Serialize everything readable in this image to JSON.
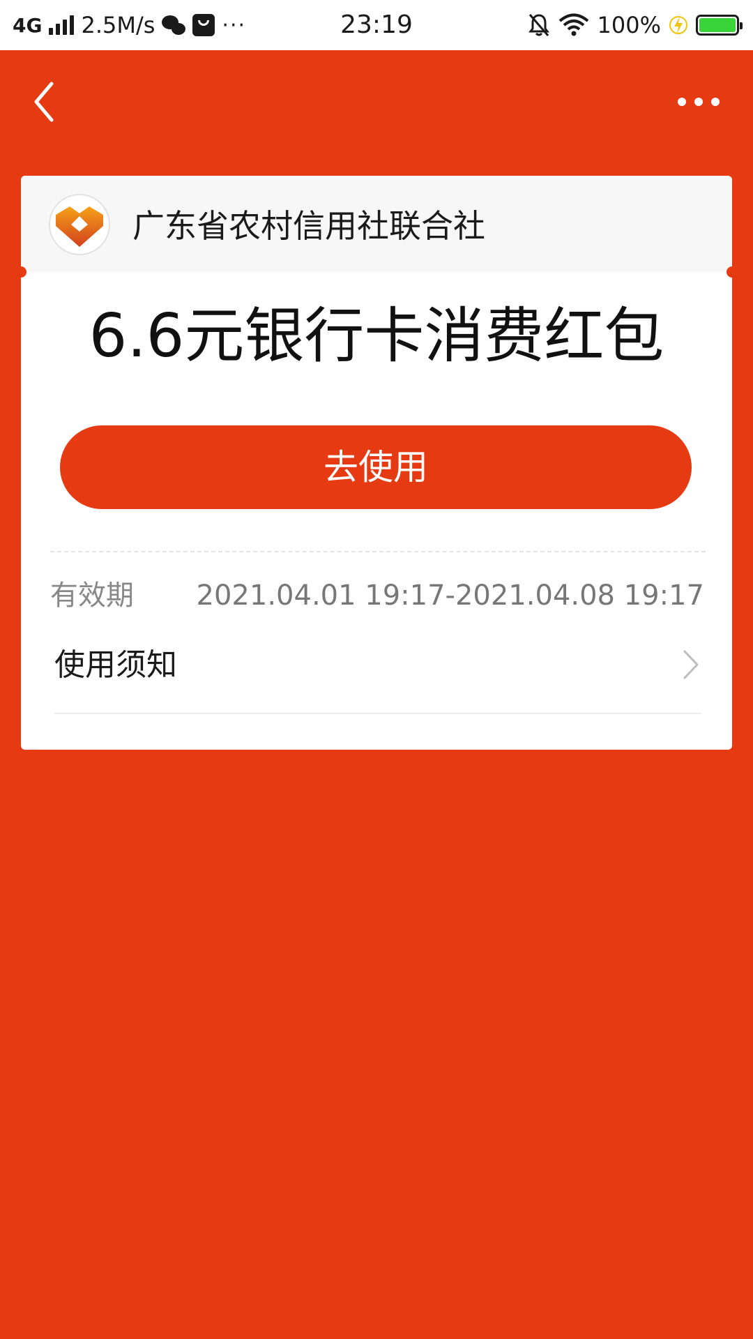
{
  "status_bar": {
    "network": "4G",
    "speed": "2.5M/s",
    "more": "···",
    "time": "23:19",
    "battery_percent": "100%",
    "battery_level": 1.0,
    "icons": [
      "signal-icon",
      "wechat-icon",
      "mail-icon",
      "bell-muted-icon",
      "wifi-icon",
      "charging-icon",
      "battery-icon"
    ]
  },
  "nav": {
    "back_icon": "chevron-left-icon",
    "more_icon": "more-dots-icon"
  },
  "card": {
    "organization": "广东省农村信用社联合社",
    "title": "6.6元银行卡消费红包",
    "use_button_label": "去使用",
    "validity_label": "有效期",
    "validity_value": "2021.04.01 19:17-2021.04.08 19:17",
    "notice_label": "使用须知"
  },
  "colors": {
    "background": "#e63b12",
    "button": "#e63b12",
    "card": "#ffffff",
    "card_header": "#f7f7f7"
  }
}
